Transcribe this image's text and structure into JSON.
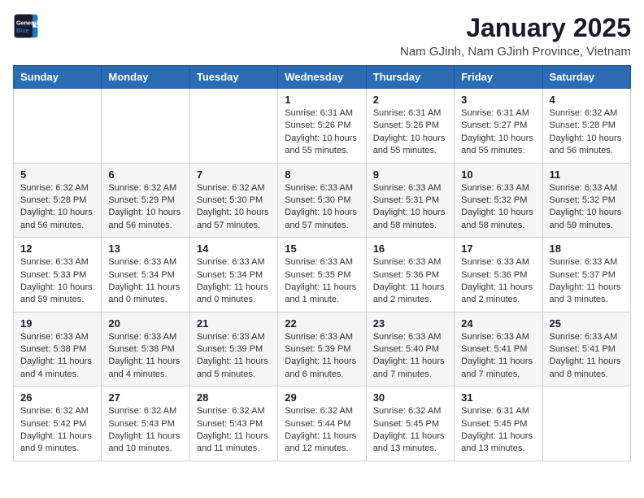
{
  "logo": {
    "line1": "General",
    "line2": "Blue"
  },
  "title": "January 2025",
  "subtitle": "Nam GJinh, Nam GJinh Province, Vietnam",
  "days_of_week": [
    "Sunday",
    "Monday",
    "Tuesday",
    "Wednesday",
    "Thursday",
    "Friday",
    "Saturday"
  ],
  "weeks": [
    [
      {
        "day": "",
        "info": ""
      },
      {
        "day": "",
        "info": ""
      },
      {
        "day": "",
        "info": ""
      },
      {
        "day": "1",
        "info": "Sunrise: 6:31 AM\nSunset: 5:26 PM\nDaylight: 10 hours and 55 minutes."
      },
      {
        "day": "2",
        "info": "Sunrise: 6:31 AM\nSunset: 5:26 PM\nDaylight: 10 hours and 55 minutes."
      },
      {
        "day": "3",
        "info": "Sunrise: 6:31 AM\nSunset: 5:27 PM\nDaylight: 10 hours and 55 minutes."
      },
      {
        "day": "4",
        "info": "Sunrise: 6:32 AM\nSunset: 5:28 PM\nDaylight: 10 hours and 56 minutes."
      }
    ],
    [
      {
        "day": "5",
        "info": "Sunrise: 6:32 AM\nSunset: 5:28 PM\nDaylight: 10 hours and 56 minutes."
      },
      {
        "day": "6",
        "info": "Sunrise: 6:32 AM\nSunset: 5:29 PM\nDaylight: 10 hours and 56 minutes."
      },
      {
        "day": "7",
        "info": "Sunrise: 6:32 AM\nSunset: 5:30 PM\nDaylight: 10 hours and 57 minutes."
      },
      {
        "day": "8",
        "info": "Sunrise: 6:33 AM\nSunset: 5:30 PM\nDaylight: 10 hours and 57 minutes."
      },
      {
        "day": "9",
        "info": "Sunrise: 6:33 AM\nSunset: 5:31 PM\nDaylight: 10 hours and 58 minutes."
      },
      {
        "day": "10",
        "info": "Sunrise: 6:33 AM\nSunset: 5:32 PM\nDaylight: 10 hours and 58 minutes."
      },
      {
        "day": "11",
        "info": "Sunrise: 6:33 AM\nSunset: 5:32 PM\nDaylight: 10 hours and 59 minutes."
      }
    ],
    [
      {
        "day": "12",
        "info": "Sunrise: 6:33 AM\nSunset: 5:33 PM\nDaylight: 10 hours and 59 minutes."
      },
      {
        "day": "13",
        "info": "Sunrise: 6:33 AM\nSunset: 5:34 PM\nDaylight: 11 hours and 0 minutes."
      },
      {
        "day": "14",
        "info": "Sunrise: 6:33 AM\nSunset: 5:34 PM\nDaylight: 11 hours and 0 minutes."
      },
      {
        "day": "15",
        "info": "Sunrise: 6:33 AM\nSunset: 5:35 PM\nDaylight: 11 hours and 1 minute."
      },
      {
        "day": "16",
        "info": "Sunrise: 6:33 AM\nSunset: 5:36 PM\nDaylight: 11 hours and 2 minutes."
      },
      {
        "day": "17",
        "info": "Sunrise: 6:33 AM\nSunset: 5:36 PM\nDaylight: 11 hours and 2 minutes."
      },
      {
        "day": "18",
        "info": "Sunrise: 6:33 AM\nSunset: 5:37 PM\nDaylight: 11 hours and 3 minutes."
      }
    ],
    [
      {
        "day": "19",
        "info": "Sunrise: 6:33 AM\nSunset: 5:38 PM\nDaylight: 11 hours and 4 minutes."
      },
      {
        "day": "20",
        "info": "Sunrise: 6:33 AM\nSunset: 5:38 PM\nDaylight: 11 hours and 4 minutes."
      },
      {
        "day": "21",
        "info": "Sunrise: 6:33 AM\nSunset: 5:39 PM\nDaylight: 11 hours and 5 minutes."
      },
      {
        "day": "22",
        "info": "Sunrise: 6:33 AM\nSunset: 5:39 PM\nDaylight: 11 hours and 6 minutes."
      },
      {
        "day": "23",
        "info": "Sunrise: 6:33 AM\nSunset: 5:40 PM\nDaylight: 11 hours and 7 minutes."
      },
      {
        "day": "24",
        "info": "Sunrise: 6:33 AM\nSunset: 5:41 PM\nDaylight: 11 hours and 7 minutes."
      },
      {
        "day": "25",
        "info": "Sunrise: 6:33 AM\nSunset: 5:41 PM\nDaylight: 11 hours and 8 minutes."
      }
    ],
    [
      {
        "day": "26",
        "info": "Sunrise: 6:32 AM\nSunset: 5:42 PM\nDaylight: 11 hours and 9 minutes."
      },
      {
        "day": "27",
        "info": "Sunrise: 6:32 AM\nSunset: 5:43 PM\nDaylight: 11 hours and 10 minutes."
      },
      {
        "day": "28",
        "info": "Sunrise: 6:32 AM\nSunset: 5:43 PM\nDaylight: 11 hours and 11 minutes."
      },
      {
        "day": "29",
        "info": "Sunrise: 6:32 AM\nSunset: 5:44 PM\nDaylight: 11 hours and 12 minutes."
      },
      {
        "day": "30",
        "info": "Sunrise: 6:32 AM\nSunset: 5:45 PM\nDaylight: 11 hours and 13 minutes."
      },
      {
        "day": "31",
        "info": "Sunrise: 6:31 AM\nSunset: 5:45 PM\nDaylight: 11 hours and 13 minutes."
      },
      {
        "day": "",
        "info": ""
      }
    ]
  ]
}
